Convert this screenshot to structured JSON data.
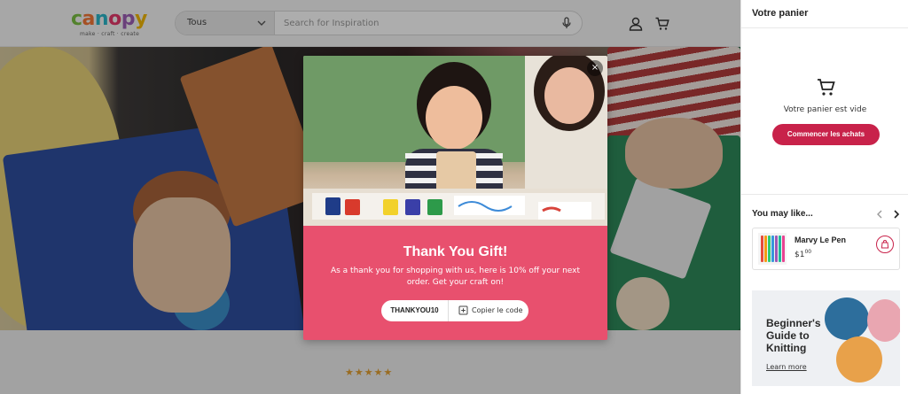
{
  "header": {
    "logo": {
      "word": "canopy",
      "tagline": "make · craft · create"
    },
    "search": {
      "category": "Tous",
      "placeholder": "Search for Inspiration"
    },
    "icons": {
      "account": "user-icon",
      "cart": "cart-icon",
      "mic": "mic-icon"
    }
  },
  "hero": {
    "rating_stars": "★★★★★"
  },
  "modal": {
    "title": "Thank You Gift!",
    "message": "As a thank you for shopping with us, here is 10% off your next order. Get your craft on!",
    "code": "THANKYOU10",
    "copy_label": "Copier le code",
    "close_label": "×",
    "accent": "#e8506e"
  },
  "cart": {
    "title": "Votre panier",
    "empty_message": "Votre panier est vide",
    "cta": "Commencer les achats",
    "accent": "#c8224a",
    "recommendations": {
      "title": "You may like...",
      "items": [
        {
          "name": "Marvy Le Pen",
          "price_main": "$1",
          "price_cents": "00"
        }
      ]
    },
    "promo": {
      "title": "Beginner's Guide to Knitting",
      "link": "Learn more"
    }
  }
}
